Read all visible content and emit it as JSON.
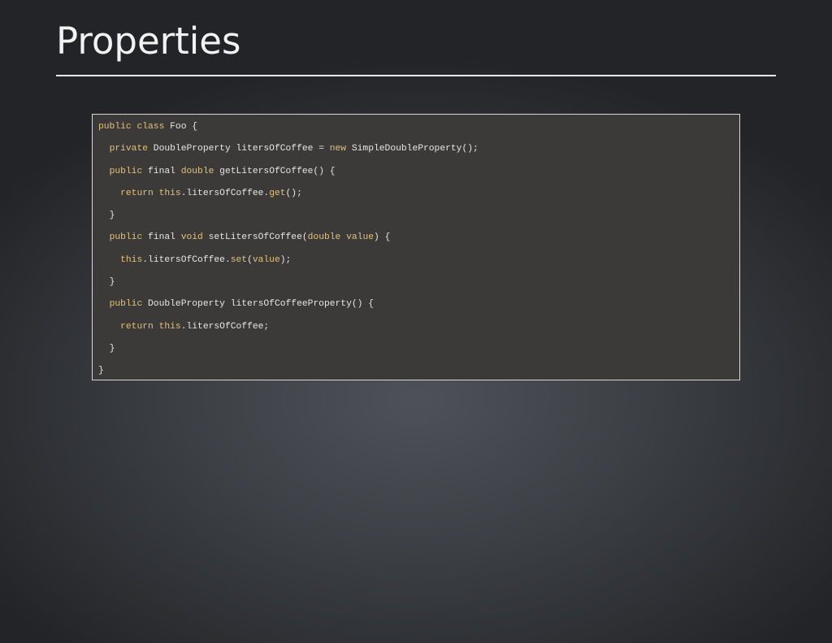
{
  "slide": {
    "title": "Properties"
  },
  "colors": {
    "keyword": "#e2c27a",
    "text": "#e6e6e6",
    "code_background": "#3b3a39",
    "page_background": "#3c3f44"
  },
  "code": {
    "language": "java",
    "lines": [
      {
        "indent": 0,
        "tokens": [
          {
            "t": "public",
            "kw": true
          },
          {
            "t": " "
          },
          {
            "t": "class",
            "kw": true
          },
          {
            "t": " Foo {"
          }
        ]
      },
      {
        "indent": 1,
        "tokens": [
          {
            "t": "private",
            "kw": true
          },
          {
            "t": " DoubleProperty litersOfCoffee = "
          },
          {
            "t": "new",
            "kw": true
          },
          {
            "t": " SimpleDoubleProperty();"
          }
        ]
      },
      {
        "indent": 1,
        "tokens": [
          {
            "t": "public",
            "kw": true
          },
          {
            "t": " final "
          },
          {
            "t": "double",
            "kw": true
          },
          {
            "t": " getLitersOfCoffee() {"
          }
        ]
      },
      {
        "indent": 2,
        "tokens": [
          {
            "t": "return",
            "kw": true
          },
          {
            "t": " "
          },
          {
            "t": "this",
            "kw": true
          },
          {
            "t": ".litersOfCoffee."
          },
          {
            "t": "get",
            "kw": true
          },
          {
            "t": "();"
          }
        ]
      },
      {
        "indent": 1,
        "tokens": [
          {
            "t": "}"
          }
        ]
      },
      {
        "indent": 1,
        "tokens": [
          {
            "t": "public",
            "kw": true
          },
          {
            "t": " final "
          },
          {
            "t": "void",
            "kw": true
          },
          {
            "t": " setLitersOfCoffee("
          },
          {
            "t": "double",
            "kw": true
          },
          {
            "t": " "
          },
          {
            "t": "value",
            "kw": true
          },
          {
            "t": ") {"
          }
        ]
      },
      {
        "indent": 2,
        "tokens": [
          {
            "t": "this",
            "kw": true
          },
          {
            "t": ".litersOfCoffee."
          },
          {
            "t": "set",
            "kw": true
          },
          {
            "t": "("
          },
          {
            "t": "value",
            "kw": true
          },
          {
            "t": ");"
          }
        ]
      },
      {
        "indent": 1,
        "tokens": [
          {
            "t": "}"
          }
        ]
      },
      {
        "indent": 1,
        "tokens": [
          {
            "t": "public",
            "kw": true
          },
          {
            "t": " DoubleProperty litersOfCoffeeProperty() {"
          }
        ]
      },
      {
        "indent": 2,
        "tokens": [
          {
            "t": "return",
            "kw": true
          },
          {
            "t": " "
          },
          {
            "t": "this",
            "kw": true
          },
          {
            "t": ".litersOfCoffee;"
          }
        ]
      },
      {
        "indent": 1,
        "tokens": [
          {
            "t": "}"
          }
        ]
      },
      {
        "indent": 0,
        "tokens": [
          {
            "t": "}"
          }
        ]
      }
    ]
  }
}
